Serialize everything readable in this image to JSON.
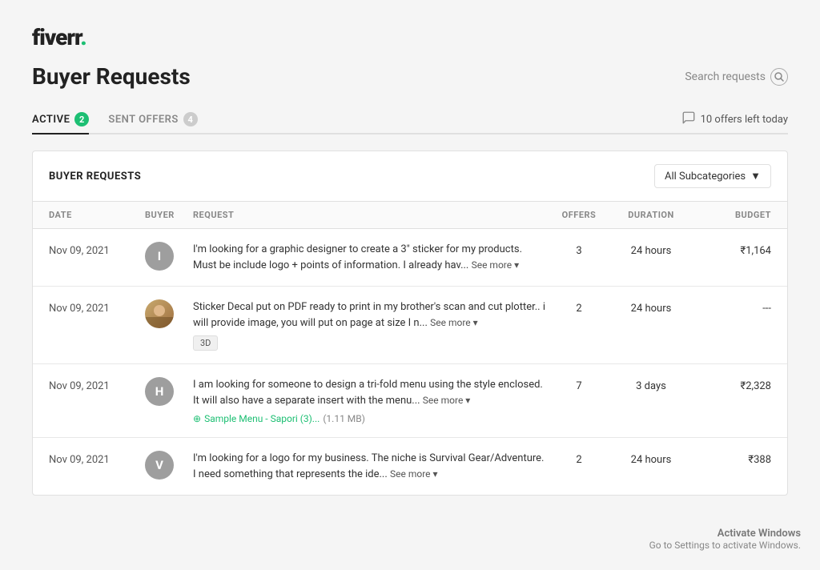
{
  "logo": {
    "text": "fiverr",
    "dot": "."
  },
  "page_title": "Buyer Requests",
  "search": {
    "placeholder": "Search requests"
  },
  "tabs": [
    {
      "id": "active",
      "label": "ACTIVE",
      "badge": "2",
      "active": true
    },
    {
      "id": "sent-offers",
      "label": "SENT OFFERS",
      "badge": "4",
      "active": false
    }
  ],
  "offers_left": "10 offers left today",
  "card": {
    "title": "BUYER REQUESTS",
    "subcategory_label": "All Subcategories"
  },
  "table": {
    "headers": [
      "DATE",
      "BUYER",
      "REQUEST",
      "OFFERS",
      "DURATION",
      "BUDGET"
    ],
    "rows": [
      {
        "date": "Nov 09, 2021",
        "buyer_initial": "I",
        "buyer_color": "#9e9e9e",
        "buyer_has_photo": false,
        "request": "I'm looking for a graphic designer to create a 3\" sticker for my products. Must be include logo + points of information. I already hav...",
        "see_more": "See more",
        "offers": "3",
        "duration": "24 hours",
        "budget": "₹1,164",
        "tag": null,
        "attachment": null
      },
      {
        "date": "Nov 09, 2021",
        "buyer_initial": "",
        "buyer_color": "#c8a96e",
        "buyer_has_photo": true,
        "request": "Sticker Decal put on PDF ready to print in my brother's scan and cut plotter.. i will provide image, you will put on page at size I n...",
        "see_more": "See more",
        "offers": "2",
        "duration": "24 hours",
        "budget": "---",
        "tag": "3D",
        "attachment": null
      },
      {
        "date": "Nov 09, 2021",
        "buyer_initial": "H",
        "buyer_color": "#9e9e9e",
        "buyer_has_photo": false,
        "request": "I am looking for someone to design a tri-fold menu using the style enclosed. It will also have a separate insert with the menu...",
        "see_more": "See more",
        "offers": "7",
        "duration": "3 days",
        "budget": "₹2,328",
        "tag": null,
        "attachment": {
          "name": "Sample Menu - Sapori (3)...",
          "size": "(1.11 MB)"
        }
      },
      {
        "date": "Nov 09, 2021",
        "buyer_initial": "V",
        "buyer_color": "#9e9e9e",
        "buyer_has_photo": false,
        "request": "I'm looking for a logo for my business. The niche is Survival Gear/Adventure. I need something that represents the ide...",
        "see_more": "See more",
        "offers": "2",
        "duration": "24 hours",
        "budget": "₹388",
        "tag": null,
        "attachment": null
      }
    ]
  },
  "activate_windows": {
    "title": "Activate Windows",
    "subtitle": "Go to Settings to activate Windows."
  }
}
